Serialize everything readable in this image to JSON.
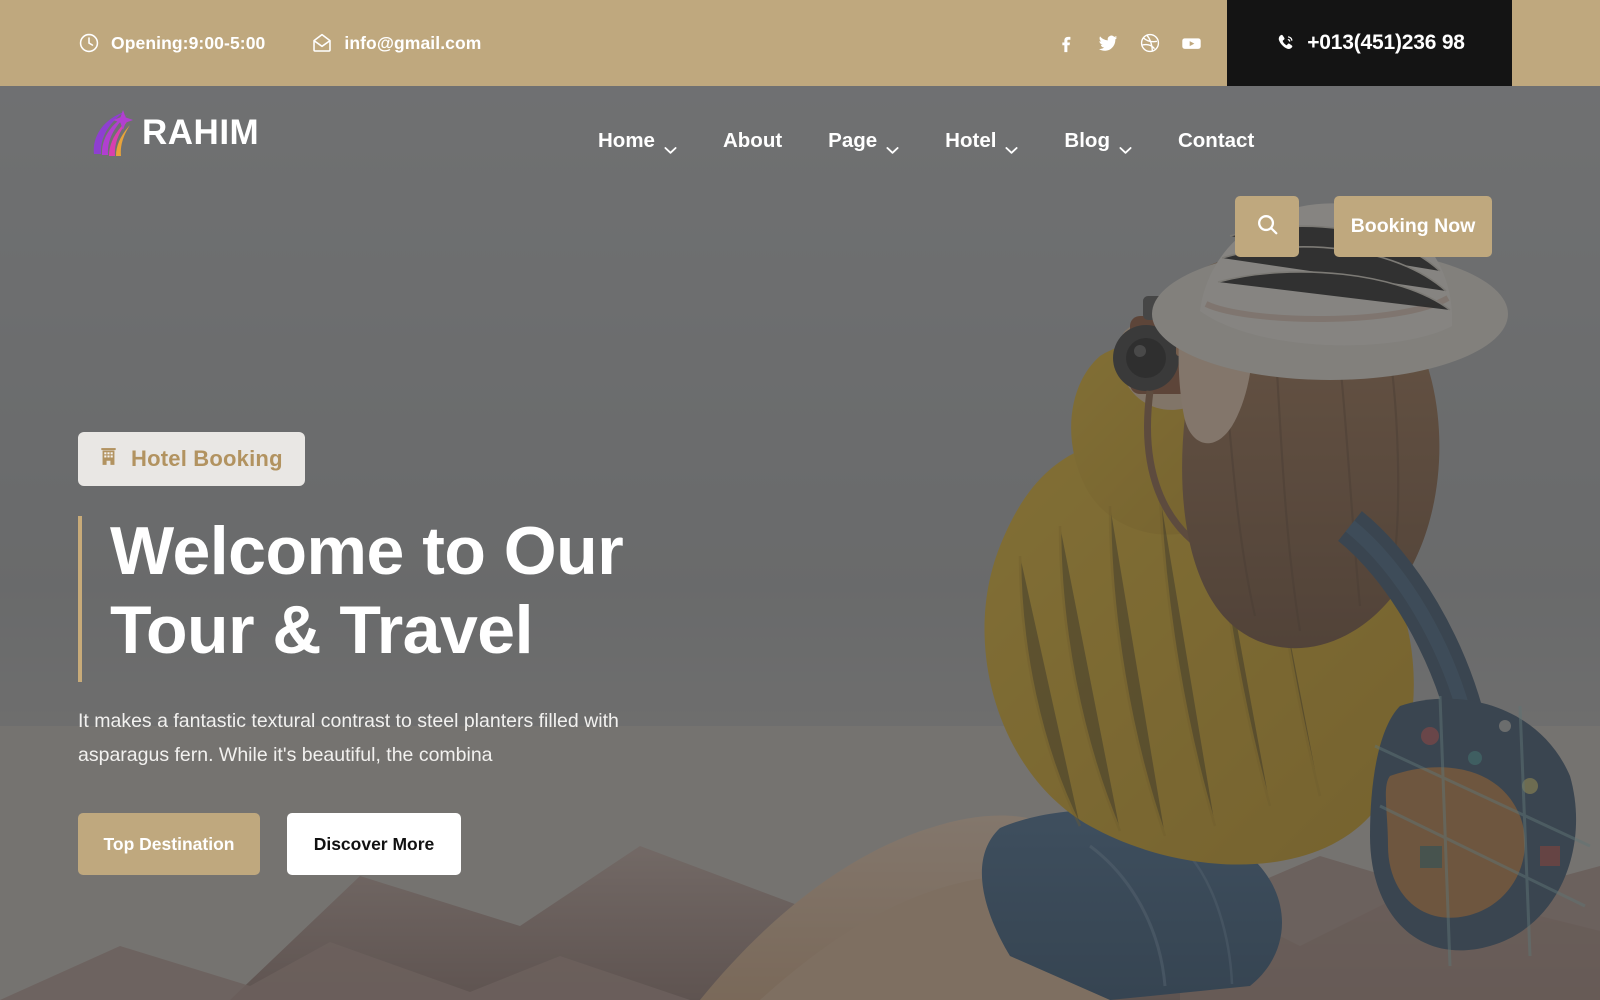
{
  "topbar": {
    "opening": {
      "icon": "clock-icon",
      "label": "Opening:9:00-5:00"
    },
    "email": {
      "icon": "envelope-icon",
      "label": "info@gmail.com"
    },
    "socials": [
      {
        "name": "facebook-icon",
        "label": "Facebook"
      },
      {
        "name": "twitter-icon",
        "label": "Twitter"
      },
      {
        "name": "dribbble-icon",
        "label": "Dribbble"
      },
      {
        "name": "youtube-icon",
        "label": "YouTube"
      }
    ],
    "phone": {
      "icon": "phone-icon",
      "number": "+013(451)236 98"
    },
    "bg_color": "#bfa87e",
    "phone_bg_color": "#141414"
  },
  "nav": {
    "logo": {
      "text": "RAHIM",
      "icon": "comet-star-logo"
    },
    "items": [
      {
        "label": "Home",
        "has_dropdown": true
      },
      {
        "label": "About",
        "has_dropdown": false
      },
      {
        "label": "Page",
        "has_dropdown": true
      },
      {
        "label": "Hotel",
        "has_dropdown": true
      },
      {
        "label": "Blog",
        "has_dropdown": true
      },
      {
        "label": "Contact",
        "has_dropdown": false
      }
    ],
    "search": {
      "icon": "search-icon"
    },
    "booking_button": {
      "label": "Booking Now"
    }
  },
  "hero": {
    "badge": {
      "icon": "hotel-building-icon",
      "label": "Hotel Booking"
    },
    "title_line1": "Welcome to Our",
    "title_line2": "Tour & Travel",
    "description": "It makes a fantastic textural contrast to steel planters filled with asparagus fern. While it's beautiful, the combina",
    "primary_button": "Top Destination",
    "secondary_button": "Discover More",
    "accent_color": "#c8ab79",
    "overlay_color": "#666666"
  }
}
